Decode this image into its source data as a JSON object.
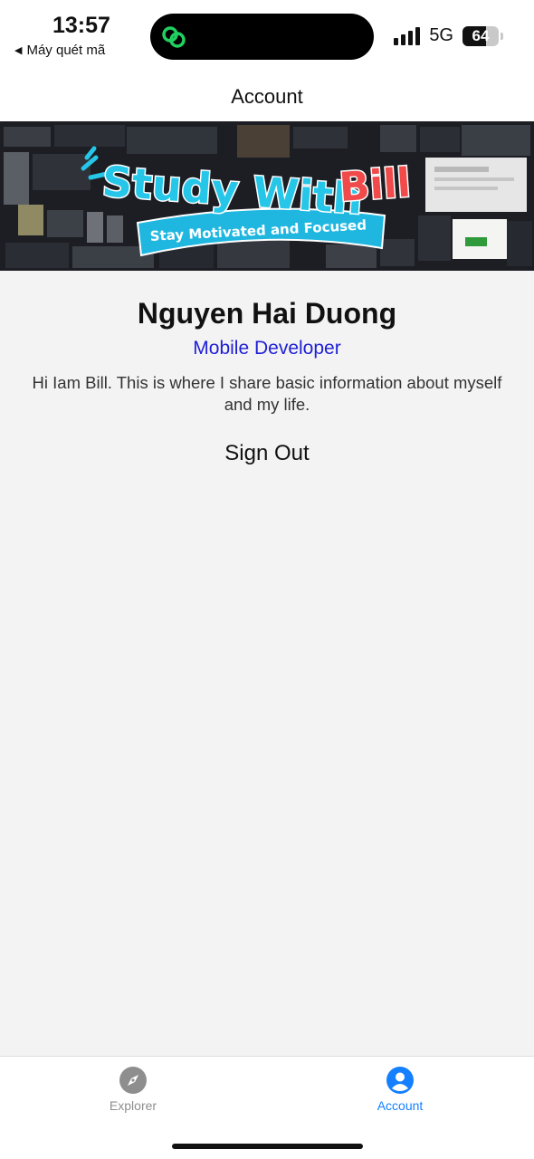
{
  "status_bar": {
    "time": "13:57",
    "back_label": "Máy quét mã",
    "back_icon": "back-triangle-icon",
    "network": "5G",
    "battery_level": "64",
    "battery_fraction": 0.64,
    "signal_bars": 4
  },
  "header": {
    "title": "Account"
  },
  "banner": {
    "title_part1": "Study With",
    "title_part2": "Bill",
    "ribbon_text": "Stay Motivated and Focused",
    "colors": {
      "title": "#26c6e8",
      "accent": "#f04a4a",
      "ribbon": "#1fb7e0"
    }
  },
  "profile": {
    "name": "Nguyen Hai Duong",
    "role": "Mobile Developer",
    "bio": "Hi Iam Bill. This is where I share basic information about myself and my life.",
    "sign_out_label": "Sign Out"
  },
  "tab_bar": {
    "items": [
      {
        "label": "Explorer",
        "icon": "compass-icon",
        "active": false
      },
      {
        "label": "Account",
        "icon": "user-circle-icon",
        "active": true
      }
    ],
    "active_color": "#1480ff",
    "inactive_color": "#8e8e8e"
  }
}
